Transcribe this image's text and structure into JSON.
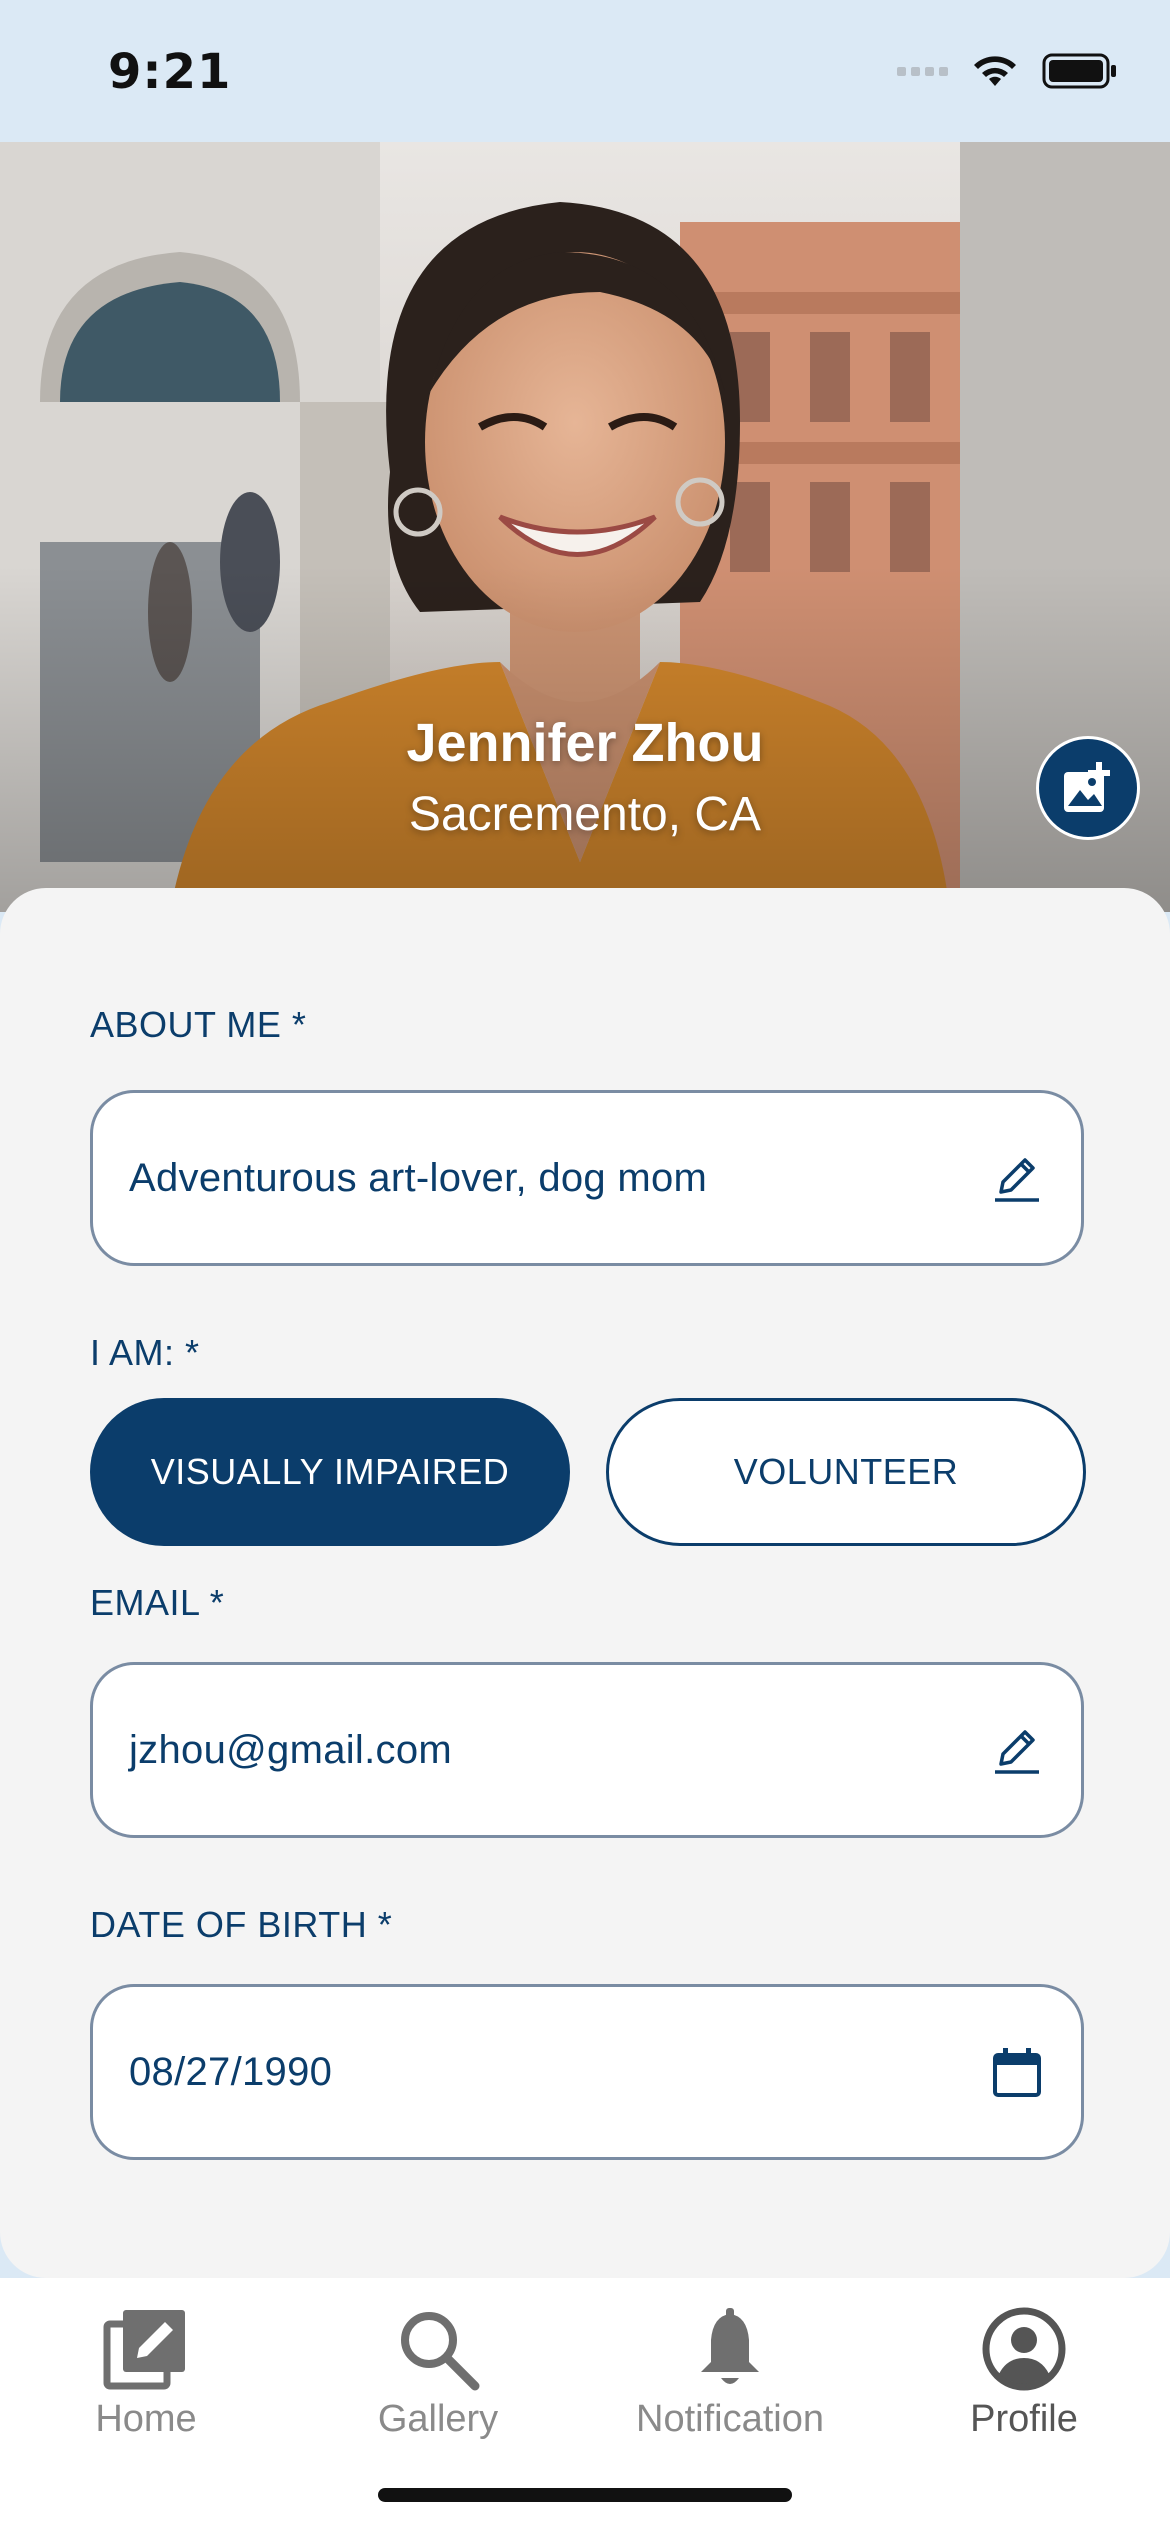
{
  "status_bar": {
    "time": "9:21"
  },
  "profile": {
    "name": "Jennifer Zhou",
    "location": "Sacremento, CA"
  },
  "about": {
    "label": "ABOUT ME *",
    "value": "Adventurous art-lover, dog mom"
  },
  "role": {
    "label": "I AM: *",
    "options": [
      "VISUALLY IMPAIRED",
      "VOLUNTEER"
    ],
    "selected": "VISUALLY IMPAIRED"
  },
  "email": {
    "label": "EMAIL *",
    "value": "jzhou@gmail.com"
  },
  "dob": {
    "label": "DATE OF BIRTH *",
    "value": "08/27/1990"
  },
  "tabs": [
    {
      "label": "Home",
      "icon": "edit-square-icon"
    },
    {
      "label": "Gallery",
      "icon": "search-icon"
    },
    {
      "label": "Notification",
      "icon": "bell-icon"
    },
    {
      "label": "Profile",
      "icon": "account-circle-icon"
    }
  ],
  "active_tab": "Profile",
  "colors": {
    "primary": "#0b3d6b",
    "background": "#f4f4f4",
    "status_bar": "#dbe9f5"
  },
  "icons": {
    "photo_button": "add-photo-icon",
    "about_edit": "pencil-icon",
    "email_edit": "pencil-icon",
    "dob_picker": "calendar-icon"
  }
}
